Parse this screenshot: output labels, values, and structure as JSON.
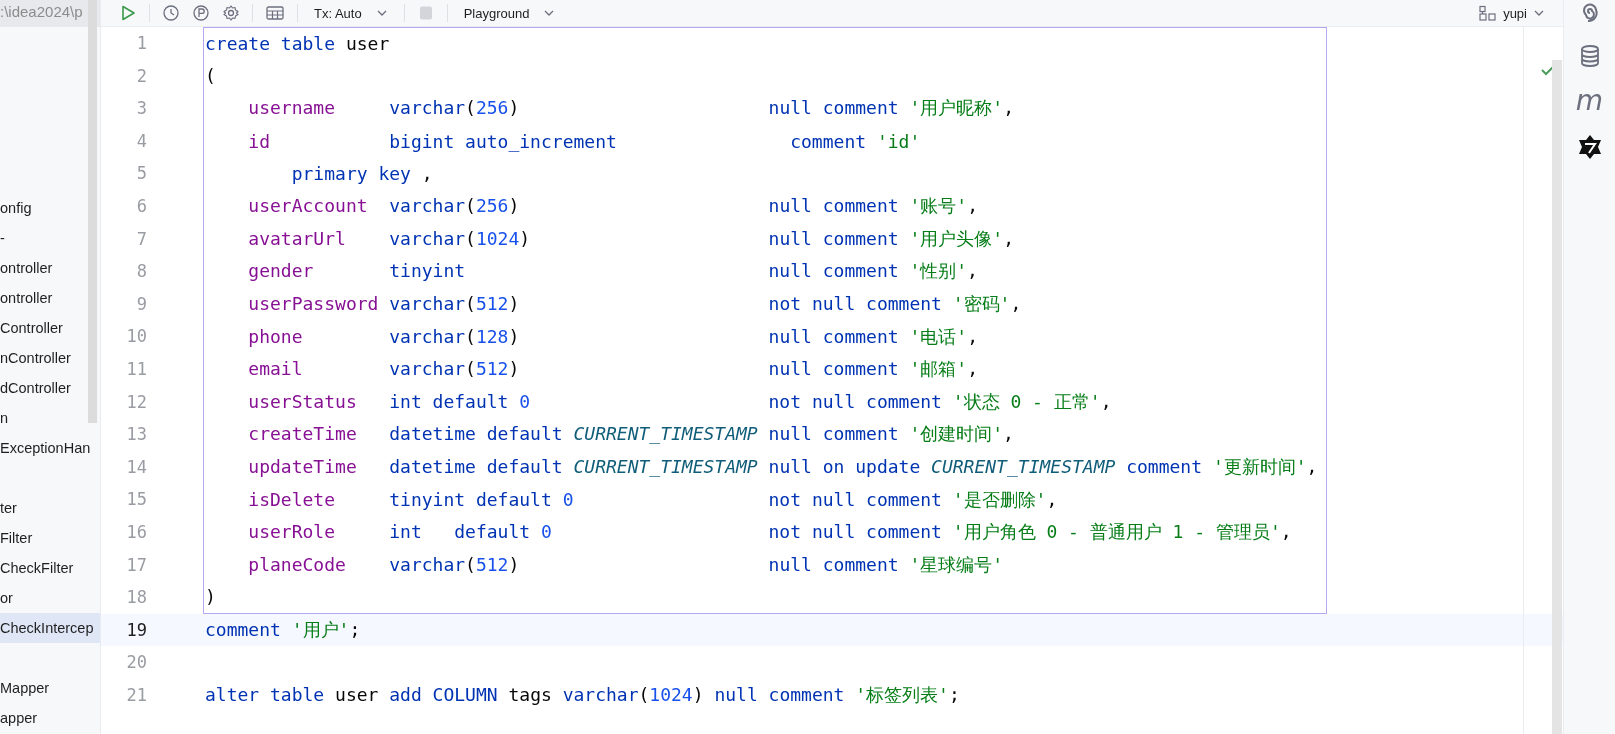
{
  "project_panel": {
    "path": ":\\idea2024\\p",
    "items": [
      {
        "kind": "entry",
        "label": "onfig",
        "selected": false
      },
      {
        "kind": "entry",
        "label": "-",
        "selected": false
      },
      {
        "kind": "entry",
        "label": "ontroller",
        "selected": false
      },
      {
        "kind": "entry",
        "label": "ontroller",
        "selected": false
      },
      {
        "kind": "entry",
        "label": "Controller",
        "selected": false
      },
      {
        "kind": "entry",
        "label": "nController",
        "selected": false
      },
      {
        "kind": "entry",
        "label": "dController",
        "selected": false
      },
      {
        "kind": "entry",
        "label": "n",
        "selected": false
      },
      {
        "kind": "entry",
        "label": "ExceptionHan",
        "selected": false
      },
      {
        "kind": "blank"
      },
      {
        "kind": "entry",
        "label": "ter",
        "selected": false
      },
      {
        "kind": "entry",
        "label": "Filter",
        "selected": false
      },
      {
        "kind": "entry",
        "label": "CheckFilter",
        "selected": false
      },
      {
        "kind": "entry",
        "label": "or",
        "selected": false
      },
      {
        "kind": "entry",
        "label": "CheckIntercep",
        "selected": true
      },
      {
        "kind": "blank"
      },
      {
        "kind": "entry",
        "label": "Mapper",
        "selected": false
      },
      {
        "kind": "entry",
        "label": "apper",
        "selected": false
      }
    ]
  },
  "toolbar": {
    "transaction_mode": "Tx: Auto",
    "schema": "Playground",
    "user": "yupi"
  },
  "side_strip": {
    "glyph": "m"
  },
  "editor": {
    "lines": [
      {
        "number": "1",
        "boxed": true,
        "current": false,
        "tokens": [
          {
            "kind": "kw",
            "text": "create table "
          },
          {
            "kind": "plain",
            "text": "user"
          }
        ]
      },
      {
        "number": "2",
        "boxed": true,
        "current": false,
        "tokens": [
          {
            "kind": "plain",
            "text": "("
          }
        ]
      },
      {
        "number": "3",
        "boxed": true,
        "current": false,
        "tokens": [
          {
            "kind": "col",
            "text": "    username     "
          },
          {
            "kind": "kw",
            "text": "varchar"
          },
          {
            "kind": "plain",
            "text": "("
          },
          {
            "kind": "num",
            "text": "256"
          },
          {
            "kind": "plain",
            "text": ")                       "
          },
          {
            "kind": "kw",
            "text": "null comment "
          },
          {
            "kind": "str",
            "text": "'用户昵称'"
          },
          {
            "kind": "plain",
            "text": ","
          }
        ]
      },
      {
        "number": "4",
        "boxed": true,
        "current": false,
        "tokens": [
          {
            "kind": "col",
            "text": "    id           "
          },
          {
            "kind": "kw",
            "text": "bigint auto_increment                comment "
          },
          {
            "kind": "str",
            "text": "'id'"
          }
        ]
      },
      {
        "number": "5",
        "boxed": true,
        "current": false,
        "tokens": [
          {
            "kind": "kw",
            "text": "        primary key "
          },
          {
            "kind": "plain",
            "text": ","
          }
        ]
      },
      {
        "number": "6",
        "boxed": true,
        "current": false,
        "tokens": [
          {
            "kind": "col",
            "text": "    userAccount  "
          },
          {
            "kind": "kw",
            "text": "varchar"
          },
          {
            "kind": "plain",
            "text": "("
          },
          {
            "kind": "num",
            "text": "256"
          },
          {
            "kind": "plain",
            "text": ")                       "
          },
          {
            "kind": "kw",
            "text": "null comment "
          },
          {
            "kind": "str",
            "text": "'账号'"
          },
          {
            "kind": "plain",
            "text": ","
          }
        ]
      },
      {
        "number": "7",
        "boxed": true,
        "current": false,
        "tokens": [
          {
            "kind": "col",
            "text": "    avatarUrl    "
          },
          {
            "kind": "kw",
            "text": "varchar"
          },
          {
            "kind": "plain",
            "text": "("
          },
          {
            "kind": "num",
            "text": "1024"
          },
          {
            "kind": "plain",
            "text": ")                      "
          },
          {
            "kind": "kw",
            "text": "null comment "
          },
          {
            "kind": "str",
            "text": "'用户头像'"
          },
          {
            "kind": "plain",
            "text": ","
          }
        ]
      },
      {
        "number": "8",
        "boxed": true,
        "current": false,
        "tokens": [
          {
            "kind": "col",
            "text": "    gender       "
          },
          {
            "kind": "kw",
            "text": "tinyint                            null comment "
          },
          {
            "kind": "str",
            "text": "'性别'"
          },
          {
            "kind": "plain",
            "text": ","
          }
        ]
      },
      {
        "number": "9",
        "boxed": true,
        "current": false,
        "tokens": [
          {
            "kind": "col",
            "text": "    userPassword "
          },
          {
            "kind": "kw",
            "text": "varchar"
          },
          {
            "kind": "plain",
            "text": "("
          },
          {
            "kind": "num",
            "text": "512"
          },
          {
            "kind": "plain",
            "text": ")                       "
          },
          {
            "kind": "kw",
            "text": "not null comment "
          },
          {
            "kind": "str",
            "text": "'密码'"
          },
          {
            "kind": "plain",
            "text": ","
          }
        ]
      },
      {
        "number": "10",
        "boxed": true,
        "current": false,
        "tokens": [
          {
            "kind": "col",
            "text": "    phone        "
          },
          {
            "kind": "kw",
            "text": "varchar"
          },
          {
            "kind": "plain",
            "text": "("
          },
          {
            "kind": "num",
            "text": "128"
          },
          {
            "kind": "plain",
            "text": ")                       "
          },
          {
            "kind": "kw",
            "text": "null comment "
          },
          {
            "kind": "str",
            "text": "'电话'"
          },
          {
            "kind": "plain",
            "text": ","
          }
        ]
      },
      {
        "number": "11",
        "boxed": true,
        "current": false,
        "tokens": [
          {
            "kind": "col",
            "text": "    email        "
          },
          {
            "kind": "kw",
            "text": "varchar"
          },
          {
            "kind": "plain",
            "text": "("
          },
          {
            "kind": "num",
            "text": "512"
          },
          {
            "kind": "plain",
            "text": ")                       "
          },
          {
            "kind": "kw",
            "text": "null comment "
          },
          {
            "kind": "str",
            "text": "'邮箱'"
          },
          {
            "kind": "plain",
            "text": ","
          }
        ]
      },
      {
        "number": "12",
        "boxed": true,
        "current": false,
        "tokens": [
          {
            "kind": "col",
            "text": "    userStatus   "
          },
          {
            "kind": "kw",
            "text": "int default "
          },
          {
            "kind": "num",
            "text": "0"
          },
          {
            "kind": "kw",
            "text": "                      not null comment "
          },
          {
            "kind": "str",
            "text": "'状态 0 - 正常'"
          },
          {
            "kind": "plain",
            "text": ","
          }
        ]
      },
      {
        "number": "13",
        "boxed": true,
        "current": false,
        "tokens": [
          {
            "kind": "col",
            "text": "    createTime   "
          },
          {
            "kind": "kw",
            "text": "datetime default "
          },
          {
            "kind": "const",
            "text": "CURRENT_TIMESTAMP"
          },
          {
            "kind": "kw",
            "text": " null comment "
          },
          {
            "kind": "str",
            "text": "'创建时间'"
          },
          {
            "kind": "plain",
            "text": ","
          }
        ]
      },
      {
        "number": "14",
        "boxed": true,
        "current": false,
        "tokens": [
          {
            "kind": "col",
            "text": "    updateTime   "
          },
          {
            "kind": "kw",
            "text": "datetime default "
          },
          {
            "kind": "const",
            "text": "CURRENT_TIMESTAMP"
          },
          {
            "kind": "kw",
            "text": " null on update "
          },
          {
            "kind": "const",
            "text": "CURRENT_TIMESTAMP"
          },
          {
            "kind": "kw",
            "text": " comment "
          },
          {
            "kind": "str",
            "text": "'更新时间'"
          },
          {
            "kind": "plain",
            "text": ","
          }
        ]
      },
      {
        "number": "15",
        "boxed": true,
        "current": false,
        "tokens": [
          {
            "kind": "col",
            "text": "    isDelete     "
          },
          {
            "kind": "kw",
            "text": "tinyint default "
          },
          {
            "kind": "num",
            "text": "0"
          },
          {
            "kind": "kw",
            "text": "                  not null comment "
          },
          {
            "kind": "str",
            "text": "'是否删除'"
          },
          {
            "kind": "plain",
            "text": ","
          }
        ]
      },
      {
        "number": "16",
        "boxed": true,
        "current": false,
        "tokens": [
          {
            "kind": "col",
            "text": "    userRole     "
          },
          {
            "kind": "kw",
            "text": "int   default "
          },
          {
            "kind": "num",
            "text": "0"
          },
          {
            "kind": "kw",
            "text": "                    not null comment "
          },
          {
            "kind": "str",
            "text": "'用户角色 0 - 普通用户 1 - 管理员'"
          },
          {
            "kind": "plain",
            "text": ","
          }
        ]
      },
      {
        "number": "17",
        "boxed": true,
        "current": false,
        "tokens": [
          {
            "kind": "col",
            "text": "    planeCode    "
          },
          {
            "kind": "kw",
            "text": "varchar"
          },
          {
            "kind": "plain",
            "text": "("
          },
          {
            "kind": "num",
            "text": "512"
          },
          {
            "kind": "plain",
            "text": ")                       "
          },
          {
            "kind": "kw",
            "text": "null comment "
          },
          {
            "kind": "str",
            "text": "'星球编号'"
          }
        ]
      },
      {
        "number": "18",
        "boxed": true,
        "current": false,
        "tokens": [
          {
            "kind": "plain",
            "text": ")"
          }
        ]
      },
      {
        "number": "19",
        "boxed": false,
        "current": true,
        "tokens": [
          {
            "kind": "kw",
            "text": "comment "
          },
          {
            "kind": "str",
            "text": "'用户'"
          },
          {
            "kind": "plain",
            "text": ";"
          }
        ]
      },
      {
        "number": "20",
        "boxed": false,
        "current": false
      },
      {
        "number": "21",
        "boxed": false,
        "current": false,
        "tokens": [
          {
            "kind": "kw",
            "text": "alter table "
          },
          {
            "kind": "plain",
            "text": "user "
          },
          {
            "kind": "kw",
            "text": "add COLUMN "
          },
          {
            "kind": "plain",
            "text": "tags "
          },
          {
            "kind": "kw",
            "text": "varchar"
          },
          {
            "kind": "plain",
            "text": "("
          },
          {
            "kind": "num",
            "text": "1024"
          },
          {
            "kind": "plain",
            "text": ") "
          },
          {
            "kind": "kw",
            "text": "null comment "
          },
          {
            "kind": "str",
            "text": "'标签列表'"
          },
          {
            "kind": "plain",
            "text": ";"
          }
        ]
      }
    ]
  }
}
